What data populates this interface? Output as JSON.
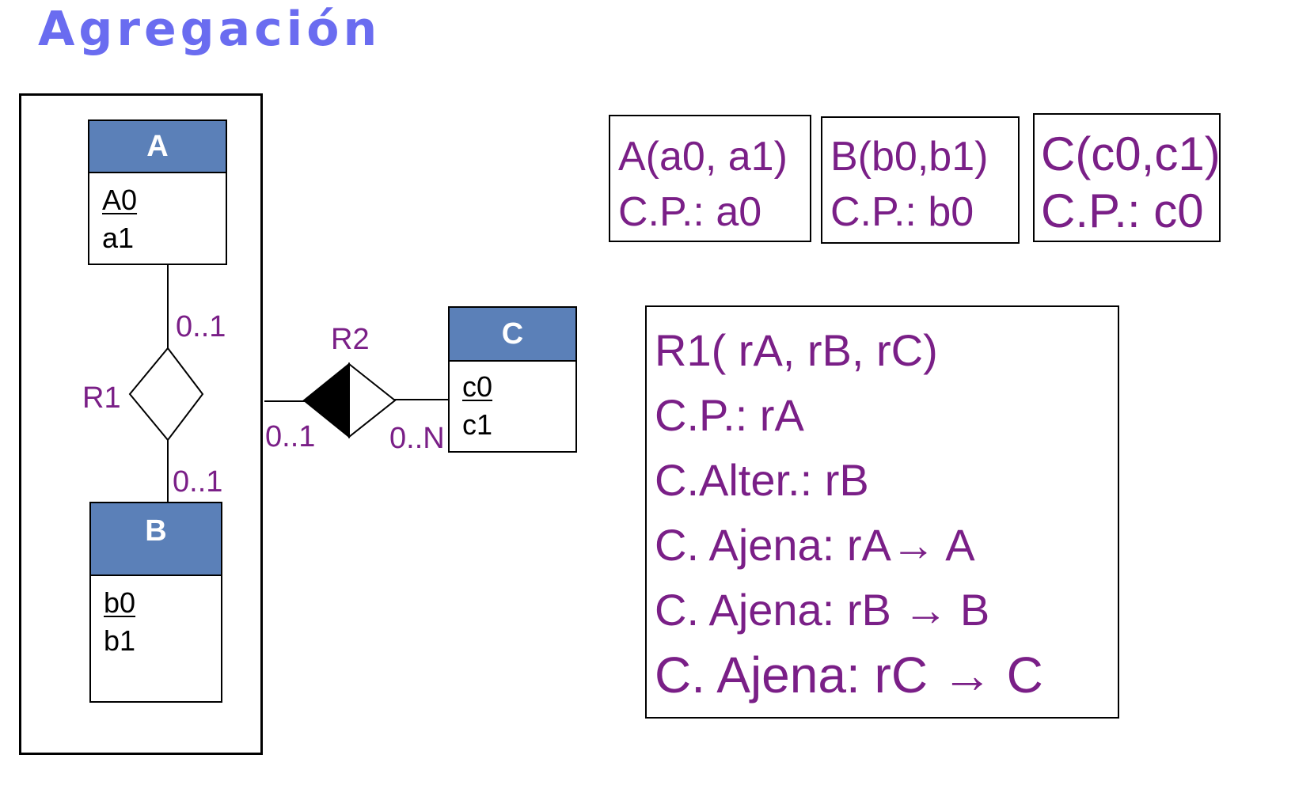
{
  "title": "Agregación",
  "entities": {
    "A": {
      "name": "A",
      "attrs": [
        "A0",
        "a1"
      ]
    },
    "B": {
      "name": "B",
      "attrs": [
        "b0",
        "b1"
      ]
    },
    "C": {
      "name": "C",
      "attrs": [
        "c0",
        "c1"
      ]
    }
  },
  "relationships": {
    "R1": {
      "name": "R1",
      "card_a": "0..1",
      "card_b": "0..1"
    },
    "R2": {
      "name": "R2",
      "card_agg": "0..1",
      "card_c": "0..N"
    }
  },
  "schemas": {
    "A": [
      "A(a0, a1)",
      "C.P.: a0"
    ],
    "B": [
      "B(b0,b1)",
      "C.P.: b0"
    ],
    "C": [
      "C(c0,c1)",
      "C.P.: c0"
    ]
  },
  "r1_schema": [
    "R1( rA, rB, rC)",
    "C.P.: rA",
    "C.Alter.: rB",
    "C. Ajena: rA→ A",
    "C. Ajena: rB → B",
    "C. Ajena: rC → C"
  ],
  "colors": {
    "title": "#6a6cf0",
    "entity_header": "#5b80b8",
    "text": "#7a1f87"
  }
}
